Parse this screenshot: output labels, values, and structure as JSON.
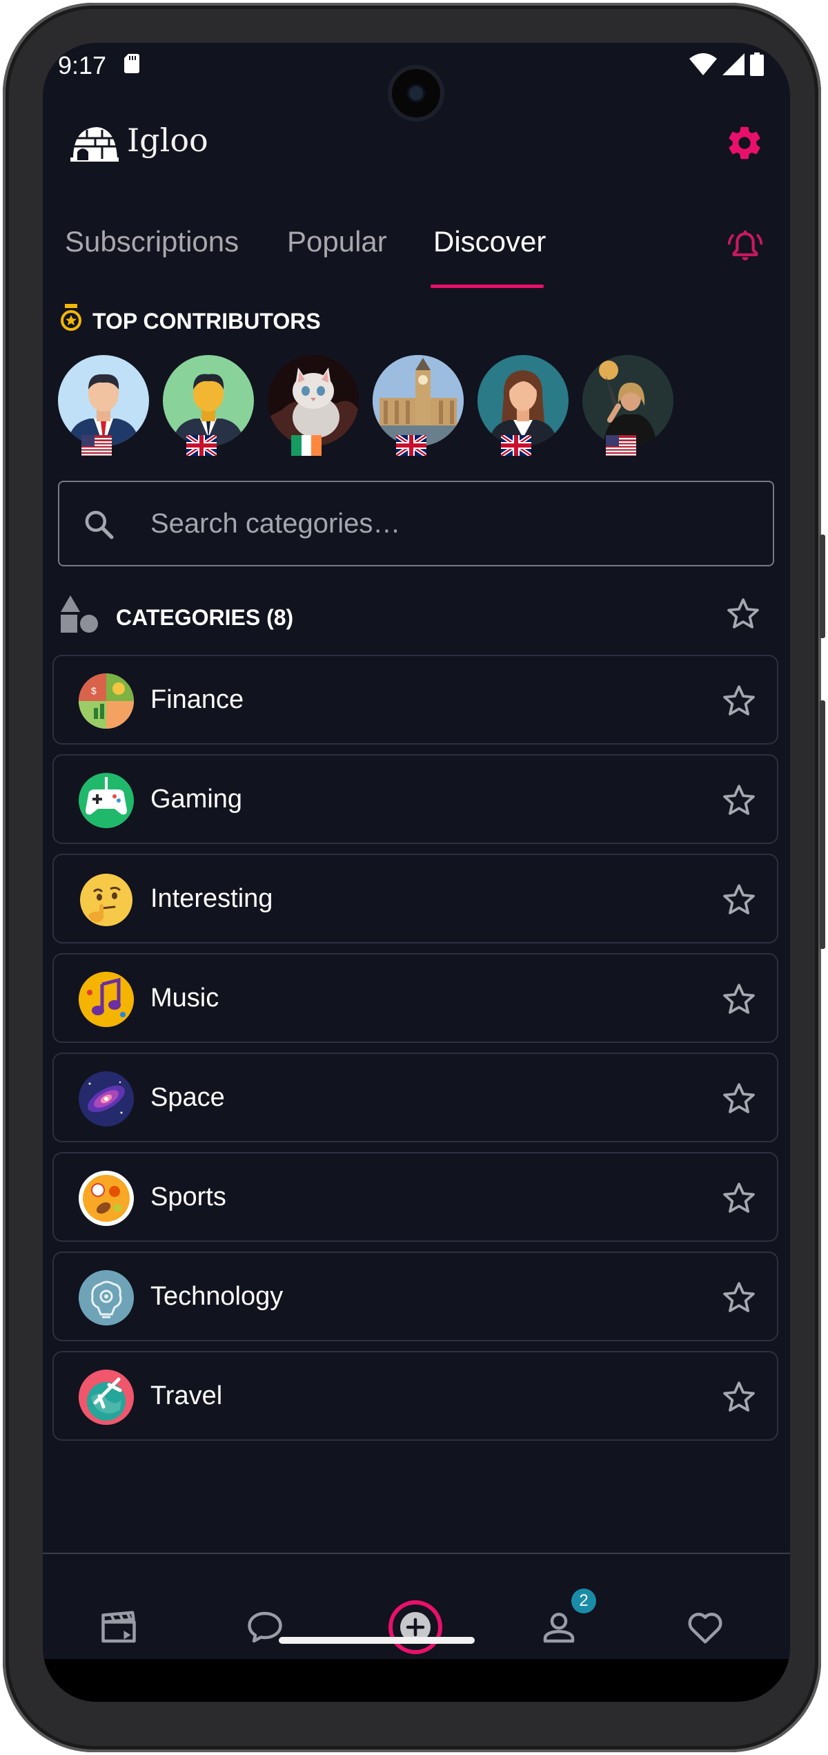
{
  "status_bar": {
    "time": "9:17"
  },
  "header": {
    "app_title": "Igloo",
    "logo_icon": "igloo-icon",
    "settings_icon": "gear-icon",
    "accent_color": "#e8106a"
  },
  "tabs": [
    {
      "label": "Subscriptions",
      "active": false
    },
    {
      "label": "Popular",
      "active": false
    },
    {
      "label": "Discover",
      "active": true
    }
  ],
  "notifications_icon": "bell-icon",
  "top_contributors": {
    "label": "TOP CONTRIBUTORS",
    "contributors": [
      {
        "avatar": "man-avatar-blue",
        "flag": "us"
      },
      {
        "avatar": "man-avatar-green",
        "flag": "uk"
      },
      {
        "avatar": "kitten-photo",
        "flag": "ie"
      },
      {
        "avatar": "big-ben-photo",
        "flag": "uk"
      },
      {
        "avatar": "woman-avatar-teal",
        "flag": "uk"
      },
      {
        "avatar": "woman-photo-torch",
        "flag": "us"
      }
    ]
  },
  "search": {
    "placeholder": "Search categories…",
    "value": ""
  },
  "categories": {
    "label": "CATEGORIES (8)",
    "items": [
      {
        "name": "Finance",
        "icon": "finance-icon"
      },
      {
        "name": "Gaming",
        "icon": "gamepad-icon"
      },
      {
        "name": "Interesting",
        "icon": "thinking-face-icon"
      },
      {
        "name": "Music",
        "icon": "music-note-icon"
      },
      {
        "name": "Space",
        "icon": "galaxy-icon"
      },
      {
        "name": "Sports",
        "icon": "sports-balls-icon"
      },
      {
        "name": "Technology",
        "icon": "brain-gear-icon"
      },
      {
        "name": "Travel",
        "icon": "airplane-globe-icon"
      }
    ]
  },
  "bottom_nav": {
    "items": [
      {
        "icon": "clapperboard-icon"
      },
      {
        "icon": "chat-bubble-icon"
      },
      {
        "icon": "add-circle-icon"
      },
      {
        "icon": "profile-icon",
        "badge": "2"
      },
      {
        "icon": "heart-icon"
      }
    ]
  }
}
